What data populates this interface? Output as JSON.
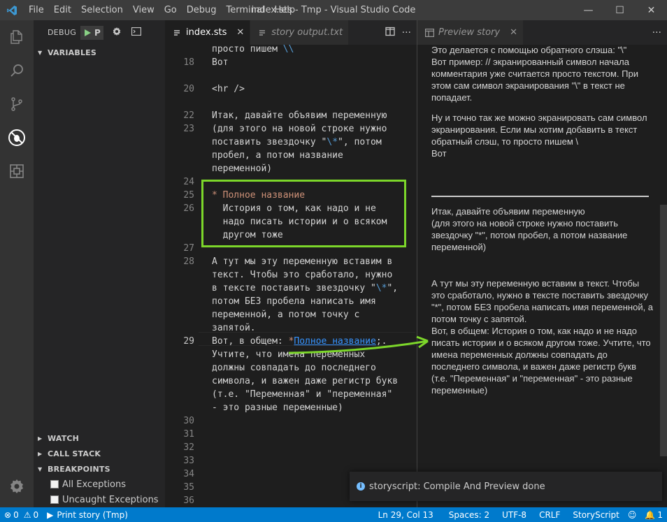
{
  "titlebar": {
    "menu": [
      "File",
      "Edit",
      "Selection",
      "View",
      "Go",
      "Debug",
      "Terminal",
      "Help"
    ],
    "window_title": "index.sts - Tmp - Visual Studio Code",
    "controls": {
      "minimize": "—",
      "maximize": "☐",
      "close": "✕"
    }
  },
  "activitybar": {
    "icons": [
      "explorer-icon",
      "search-icon",
      "source-control-icon",
      "debug-icon",
      "extensions-icon",
      "settings-gear-icon"
    ]
  },
  "sidebar": {
    "debug_label": "DEBUG",
    "debug_config": "P",
    "variables": "VARIABLES",
    "watch": "WATCH",
    "call_stack": "CALL STACK",
    "breakpoints": "BREAKPOINTS",
    "breakpoint_items": [
      "All Exceptions",
      "Uncaught Exceptions"
    ]
  },
  "editor1": {
    "tabs": [
      {
        "label": "index.sts",
        "close": "✕"
      },
      {
        "label": "story output.txt"
      }
    ],
    "lines": {
      "l17": {
        "a": "просто пишем ",
        "b": "\\\\"
      },
      "l18": {
        "num": "18",
        "text": "Вот"
      },
      "l20": {
        "num": "20",
        "text": "<hr />"
      },
      "l22": {
        "num": "22",
        "text": "Итак, давайте объявим переменную"
      },
      "l23": {
        "num": "23",
        "text": "(для этого на новой строке нужно"
      },
      "l23b": {
        "a": "поставить звездочку \"",
        "b": "\\*",
        "c": "\", потом"
      },
      "l23c": {
        "text": "пробел, а потом название"
      },
      "l23d": {
        "text": "переменной)"
      },
      "l24": {
        "num": "24"
      },
      "l25": {
        "num": "25",
        "text": "* Полное название"
      },
      "l26": {
        "num": "26",
        "text": "  История о том, как надо и не"
      },
      "l26b": {
        "text": "  надо писать истории и о всяком"
      },
      "l26c": {
        "text": "  другом тоже"
      },
      "l27": {
        "num": "27"
      },
      "l28": {
        "num": "28",
        "text": "А тут мы эту переменную вставим в"
      },
      "l28b": {
        "text": "текст. Чтобы это сработало, нужно"
      },
      "l28c": {
        "a": "в тексте поставить звездочку \"",
        "b": "\\*",
        "c": "\","
      },
      "l28d": {
        "text": "потом БЕЗ пробела написать имя"
      },
      "l28e": {
        "text": "переменной, а потом точку с"
      },
      "l28f": {
        "text": "запятой."
      },
      "l29": {
        "num": "29",
        "a": "Вот, в общем: ",
        "b": "*",
        "c": "Полное название",
        "d": ";."
      },
      "l29b": {
        "text": "Учтите, что имена переменных"
      },
      "l29c": {
        "text": "должны совпадать до последнего"
      },
      "l29d": {
        "text": "символа, и важен даже регистр букв"
      },
      "l29e": {
        "text": "(т.е. \"Переменная\" и \"переменная\""
      },
      "l29f": {
        "text": "- это разные переменные)"
      },
      "l30": {
        "num": "30"
      },
      "l31": {
        "num": "31"
      },
      "l32": {
        "num": "32"
      },
      "l33": {
        "num": "33"
      },
      "l34": {
        "num": "34"
      },
      "l35": {
        "num": "35"
      },
      "l36": {
        "num": "36"
      }
    }
  },
  "editor2": {
    "tab_label": "Preview story",
    "close": "✕",
    "paragraphs": {
      "p1": "Это делается с помощью обратного слэша: \"\\\"\nВот пример: // экранированный символ начала комментария уже считается просто текстом. При этом сам символ экранирования \"\\\" в текст не попадает.",
      "p2": "Ну и точно так же можно экранировать сам символ экранирования. Если мы хотим добавить в текст обратный слэш, то просто пишем \\\nВот",
      "p3": "Итак, давайте объявим переменную\n(для этого на новой строке нужно поставить звездочку \"*\", потом пробел, а потом название переменной)",
      "p4": "А тут мы эту переменную вставим в текст. Чтобы это сработало, нужно в тексте поставить звездочку \"*\", потом БЕЗ пробела написать имя переменной, а потом точку с запятой.\nВот, в общем: История о том, как надо и не надо писать истории и о всяком другом тоже. Учтите, что имена переменных должны совпадать до последнего символа, и важен даже регистр букв (т.е. \"Переменная\" и \"переменная\" - это разные переменные)"
    }
  },
  "toast": {
    "text": "storyscript: Compile And Preview done"
  },
  "statusbar": {
    "errors": "0",
    "warnings": "0",
    "debug_target": "Print story (Tmp)",
    "position": "Ln 29, Col 13",
    "spaces": "Spaces: 2",
    "encoding": "UTF-8",
    "eol": "CRLF",
    "language": "StoryScript",
    "notifications": "1"
  },
  "colors": {
    "statusbar": "#007acc",
    "highlight_box": "#7cd62a",
    "header": "#ce9178",
    "escape": "#569cd6",
    "reference": "#3794ff"
  }
}
